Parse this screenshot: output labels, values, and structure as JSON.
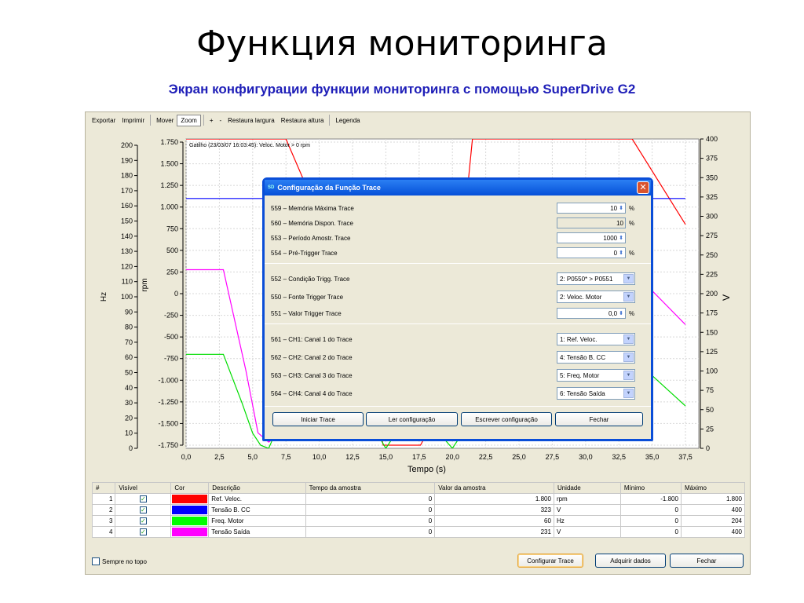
{
  "slide": {
    "title": "Функция мониторинга",
    "subtitle": "Экран конфигурации функции мониторинга с помощью SuperDrive G2"
  },
  "toolbar": {
    "items": [
      "Exportar",
      "Imprimir",
      "Mover",
      "Zoom",
      "+",
      "-",
      "Restaura largura",
      "Restaura altura",
      "Legenda"
    ],
    "active": "Zoom"
  },
  "chart": {
    "trigger_text": "Gatilho (23/03/07 16:03:45): Veloc. Motor > 0 rpm",
    "xlabel": "Tempo (s)",
    "hz_label": "Hz",
    "rpm_label": "rpm",
    "right_axis_label": "V",
    "x_ticks": [
      "0,0",
      "2,5",
      "5,0",
      "7,5",
      "10,0",
      "12,5",
      "15,0",
      "17,5",
      "20,0",
      "22,5",
      "25,0",
      "27,5",
      "30,0",
      "32,5",
      "35,0",
      "37,5"
    ],
    "hz_ticks": [
      "200",
      "190",
      "180",
      "170",
      "160",
      "150",
      "140",
      "130",
      "120",
      "110",
      "100",
      "90",
      "80",
      "70",
      "60",
      "50",
      "40",
      "30",
      "20",
      "10",
      "0"
    ],
    "rpm_ticks": [
      "1.750",
      "1.500",
      "1.250",
      "1.000",
      "750",
      "500",
      "250",
      "0",
      "-250",
      "-500",
      "-750",
      "-1.000",
      "-1.250",
      "-1.500",
      "-1.750"
    ],
    "v_ticks": [
      "400",
      "375",
      "350",
      "325",
      "300",
      "275",
      "250",
      "225",
      "200",
      "175",
      "150",
      "125",
      "100",
      "75",
      "50",
      "25",
      "0"
    ]
  },
  "chart_data": {
    "type": "line",
    "xlabel": "Tempo (s)",
    "x_range": [
      0,
      37.5
    ],
    "series": [
      {
        "name": "Ref. Veloc.",
        "axis": "rpm",
        "color": "#ff0000",
        "points": [
          [
            0,
            1800
          ],
          [
            7.5,
            1800
          ],
          [
            12.5,
            0
          ],
          [
            14.8,
            -1750
          ],
          [
            17.6,
            -1750
          ],
          [
            19.6,
            -1200
          ],
          [
            21.5,
            1800
          ],
          [
            33.5,
            1800
          ],
          [
            37.5,
            800
          ]
        ]
      },
      {
        "name": "Tensão B. CC",
        "axis": "V",
        "color": "#0000ff",
        "points": [
          [
            0,
            323
          ],
          [
            37.5,
            323
          ]
        ]
      },
      {
        "name": "Freq. Motor",
        "axis": "Hz",
        "color": "#00dd00",
        "points": [
          [
            0,
            62
          ],
          [
            2.8,
            62
          ],
          [
            4.2,
            30
          ],
          [
            5.0,
            10
          ],
          [
            5.6,
            2
          ],
          [
            6.2,
            0
          ],
          [
            6.8,
            12
          ],
          [
            14.2,
            12
          ],
          [
            15.0,
            0
          ],
          [
            15.6,
            8
          ],
          [
            19.2,
            8
          ],
          [
            20.0,
            0
          ],
          [
            20.6,
            8
          ],
          [
            33.5,
            60
          ],
          [
            37.5,
            28
          ]
        ]
      },
      {
        "name": "Tensão Saída",
        "axis": "V",
        "color": "#ff00ff",
        "points": [
          [
            0,
            231
          ],
          [
            2.8,
            231
          ],
          [
            4.5,
            100
          ],
          [
            5.4,
            20
          ],
          [
            6.2,
            8
          ],
          [
            6.8,
            15
          ],
          [
            33.5,
            230
          ],
          [
            37.5,
            160
          ]
        ]
      }
    ],
    "axes": {
      "Hz": [
        0,
        200
      ],
      "rpm": [
        -1800,
        1800
      ],
      "V": [
        0,
        400
      ]
    },
    "grid": true
  },
  "dialog": {
    "title": "Configuração da Função Trace",
    "logo": "SD",
    "params": [
      {
        "label": "559 – Memória Máxima Trace",
        "value": "10",
        "spin": true,
        "unit": "%"
      },
      {
        "label": "560 – Memória Dispon. Trace",
        "value": "10",
        "spin": false,
        "unit": "%"
      },
      {
        "label": "553 – Período Amostr. Trace",
        "value": "1000",
        "spin": true,
        "unit": ""
      },
      {
        "label": "554 – Pré-Trigger Trace",
        "value": "0",
        "spin": true,
        "unit": "%"
      }
    ],
    "trigger": [
      {
        "label": "552 – Condição Trigg. Trace",
        "value": "2: P0550* > P0551"
      },
      {
        "label": "550 – Fonte Trigger Trace",
        "value": "2: Veloc. Motor"
      }
    ],
    "trigger_value": {
      "label": "551 – Valor Trigger Trace",
      "value": "0,0",
      "unit": "%"
    },
    "channels": [
      {
        "label": "561 – CH1: Canal 1 do Trace",
        "value": "1: Ref. Veloc."
      },
      {
        "label": "562 – CH2: Canal 2 do Trace",
        "value": "4: Tensão B. CC"
      },
      {
        "label": "563 – CH3: Canal 3 do Trace",
        "value": "5: Freq. Motor"
      },
      {
        "label": "564 – CH4: Canal 4 do Trace",
        "value": "6: Tensão Saída"
      }
    ],
    "buttons": [
      "Iniciar Trace",
      "Ler configuração",
      "Escrever configuração",
      "Fechar"
    ]
  },
  "table": {
    "headers": [
      "#",
      "Visível",
      "Cor",
      "Descrição",
      "Tempo da amostra",
      "Valor da amostra",
      "Unidade",
      "Mínimo",
      "Máximo"
    ],
    "rows": [
      {
        "n": "1",
        "color": "#ff0000",
        "desc": "Ref. Veloc.",
        "time": "0",
        "value": "1.800",
        "unit": "rpm",
        "min": "-1.800",
        "max": "1.800"
      },
      {
        "n": "2",
        "color": "#0000ff",
        "desc": "Tensão B. CC",
        "time": "0",
        "value": "323",
        "unit": "V",
        "min": "0",
        "max": "400"
      },
      {
        "n": "3",
        "color": "#00ff00",
        "desc": "Freq. Motor",
        "time": "0",
        "value": "60",
        "unit": "Hz",
        "min": "0",
        "max": "204"
      },
      {
        "n": "4",
        "color": "#ff00ff",
        "desc": "Tensão Saída",
        "time": "0",
        "value": "231",
        "unit": "V",
        "min": "0",
        "max": "400"
      }
    ]
  },
  "footer": {
    "sempre_label": "Sempre no topo",
    "buttons": [
      "Configurar Trace",
      "Adquirir dados",
      "Fechar"
    ]
  }
}
